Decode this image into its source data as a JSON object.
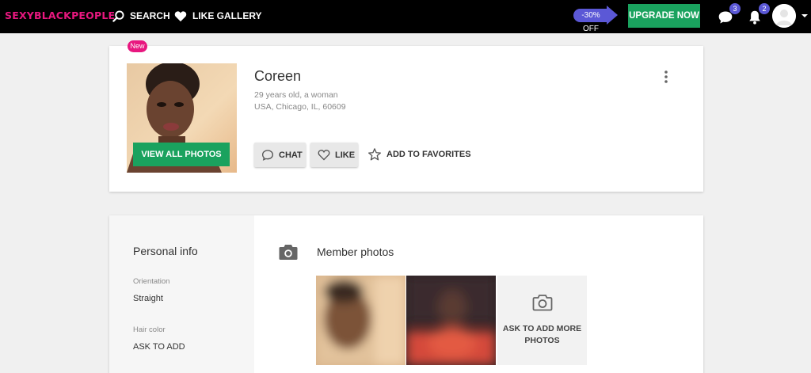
{
  "header": {
    "logo_part1": "SEXYBLACK",
    "logo_part2": "PEOPLE",
    "nav": {
      "search": "SEARCH",
      "like_gallery": "LIKE GALLERY"
    },
    "discount": "-30% OFF",
    "upgrade": "UPGRADE NOW",
    "messages_count": "3",
    "notifications_count": "2"
  },
  "profile": {
    "new_badge": "New",
    "name": "Coreen",
    "age_gender": "29 years old, a woman",
    "location": "USA, Chicago, IL, 60609",
    "view_photos": "VIEW ALL PHOTOS",
    "chat": "CHAT",
    "like": "LIKE",
    "favorites": "ADD TO FAVORITES"
  },
  "personal_info": {
    "title": "Personal info",
    "fields": [
      {
        "label": "Orientation",
        "value": "Straight"
      },
      {
        "label": "Hair color",
        "value": "ASK TO ADD"
      }
    ]
  },
  "member_photos": {
    "title": "Member photos",
    "add_more": "ASK TO ADD MORE PHOTOS"
  },
  "colors": {
    "brand_pink": "#e8177f",
    "accent_purple": "#5b58d6",
    "green": "#1aa25e"
  }
}
